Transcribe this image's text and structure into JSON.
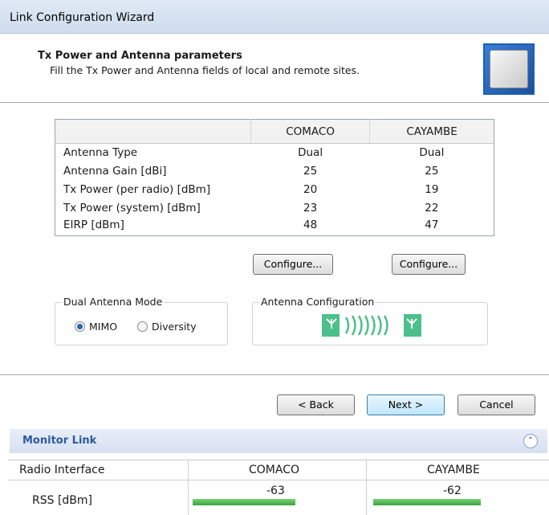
{
  "window": {
    "title": "Link Configuration Wizard"
  },
  "header": {
    "title": "Tx Power and Antenna parameters",
    "subtitle": "Fill the Tx Power and Antenna fields of local and remote sites.",
    "icon": "antenna-panel-icon"
  },
  "params_table": {
    "columns": [
      "",
      "COMACO",
      "CAYAMBE"
    ],
    "rows": [
      {
        "label": "Antenna Type",
        "comaco": "Dual",
        "cayambe": "Dual"
      },
      {
        "label": "Antenna Gain [dBi]",
        "comaco": "25",
        "cayambe": "25"
      },
      {
        "label": "Tx Power (per radio) [dBm]",
        "comaco": "20",
        "cayambe": "19"
      },
      {
        "label": "Tx Power (system) [dBm]",
        "comaco": "23",
        "cayambe": "22"
      },
      {
        "label": "EIRP [dBm]",
        "comaco": "48",
        "cayambe": "47"
      }
    ]
  },
  "configure_buttons": {
    "comaco": "Configure...",
    "cayambe": "Configure..."
  },
  "dual_antenna_mode": {
    "legend": "Dual Antenna Mode",
    "options": [
      {
        "label": "MIMO",
        "selected": true
      },
      {
        "label": "Diversity",
        "selected": false
      }
    ]
  },
  "antenna_configuration": {
    "legend": "Antenna Configuration",
    "icon": "dual-antenna-link-icon"
  },
  "nav_buttons": {
    "back": "< Back",
    "next": "Next >",
    "cancel": "Cancel"
  },
  "monitor": {
    "title": "Monitor Link",
    "headers": [
      "Radio Interface",
      "COMACO",
      "CAYAMBE"
    ],
    "rss": {
      "label": "RSS [dBm]",
      "comaco": "-63",
      "cayambe": "-62"
    }
  },
  "colors": {
    "accent": "#2c5aa0",
    "signal": "#3aa53a",
    "antenna_green": "#4cc08a"
  }
}
